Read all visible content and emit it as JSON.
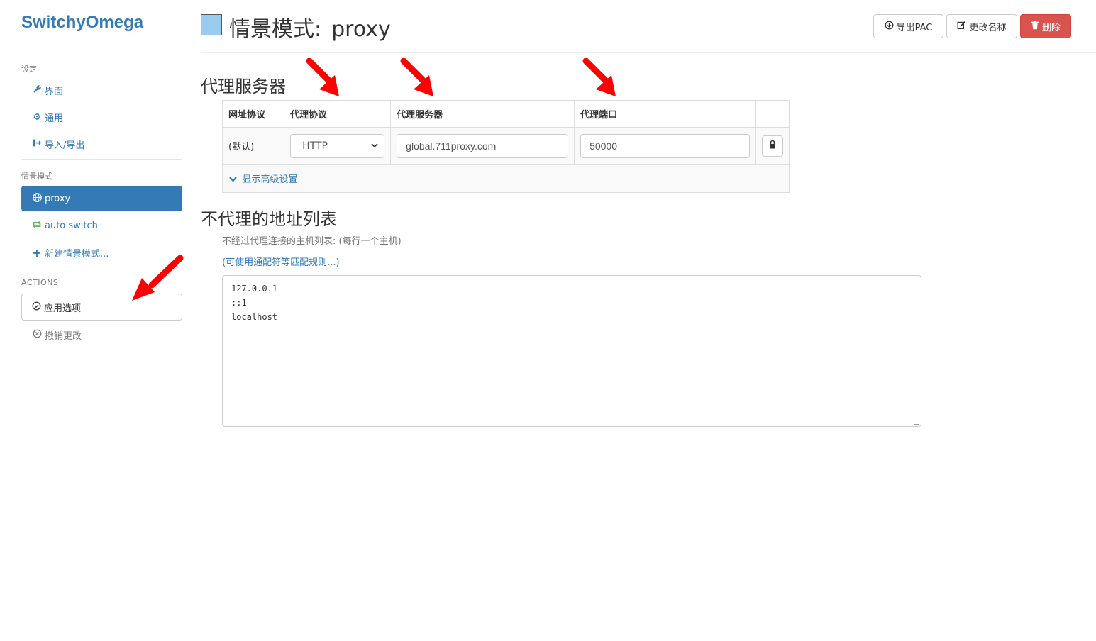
{
  "brand": "SwitchyOmega",
  "sidebar": {
    "settings_header": "设定",
    "settings_items": [
      {
        "label": "界面",
        "icon": "wrench-icon"
      },
      {
        "label": "通用",
        "icon": "gear-icon"
      },
      {
        "label": "导入/导出",
        "icon": "import-export-icon"
      }
    ],
    "profiles_header": "情景模式",
    "profile_items": [
      {
        "label": "proxy",
        "icon": "globe-icon",
        "active": true
      },
      {
        "label": "auto switch",
        "icon": "retweet-icon"
      },
      {
        "label": "新建情景模式...",
        "icon": "plus-icon"
      }
    ],
    "actions_header": "ACTIONS",
    "apply_label": "应用选项",
    "discard_label": "撤销更改"
  },
  "header": {
    "title_prefix": "情景模式:",
    "profile_name": "proxy",
    "profile_color": "#99ccee",
    "export_pac_label": "导出PAC",
    "rename_label": "更改名称",
    "delete_label": "删除"
  },
  "proxy_section": {
    "title": "代理服务器",
    "columns": [
      "网址协议",
      "代理协议",
      "代理服务器",
      "代理端口",
      ""
    ],
    "rows": [
      {
        "scheme": "(默认)",
        "protocol": "HTTP",
        "server": "global.711proxy.com",
        "port": "50000"
      }
    ],
    "advanced_label": "显示高级设置"
  },
  "bypass_section": {
    "title": "不代理的地址列表",
    "help_text": "不经过代理连接的主机列表: (每行一个主机)",
    "help_link": "(可使用通配符等匹配规则...)",
    "lines": [
      "127.0.0.1",
      "::1",
      "localhost"
    ]
  },
  "colors": {
    "accent": "#337ab7",
    "danger": "#d9534f",
    "success": "#5cb85c",
    "annotation": "#ff0000"
  }
}
